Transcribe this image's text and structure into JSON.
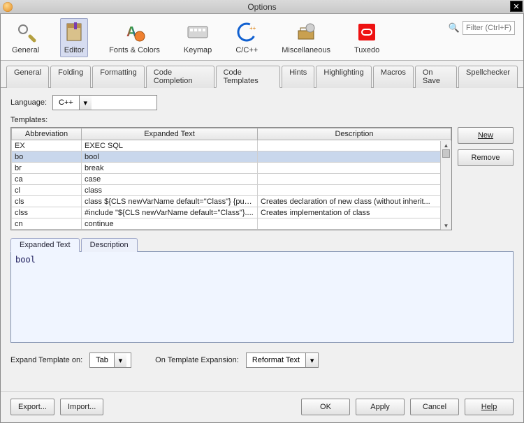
{
  "title": "Options",
  "search_placeholder": "Filter (Ctrl+F)",
  "toolbar": [
    {
      "label": "General"
    },
    {
      "label": "Editor",
      "selected": true
    },
    {
      "label": "Fonts & Colors"
    },
    {
      "label": "Keymap"
    },
    {
      "label": "C/C++"
    },
    {
      "label": "Miscellaneous"
    },
    {
      "label": "Tuxedo"
    }
  ],
  "inner_tabs": [
    "General",
    "Folding",
    "Formatting",
    "Code Completion",
    "Code Templates",
    "Hints",
    "Highlighting",
    "Macros",
    "On Save",
    "Spellchecker"
  ],
  "inner_tab_active": "Code Templates",
  "language_label": "Language:",
  "language_value": "C++",
  "templates_label": "Templates:",
  "columns": [
    "Abbreviation",
    "Expanded Text",
    "Description"
  ],
  "rows": [
    {
      "abbr": "EX",
      "exp": "EXEC SQL",
      "desc": ""
    },
    {
      "abbr": "bo",
      "exp": "bool",
      "desc": "",
      "selected": true
    },
    {
      "abbr": "br",
      "exp": "break",
      "desc": ""
    },
    {
      "abbr": "ca",
      "exp": "case",
      "desc": ""
    },
    {
      "abbr": "cl",
      "exp": "class",
      "desc": ""
    },
    {
      "abbr": "cls",
      "exp": "class ${CLS newVarName default=\"Class\"} {pub...",
      "desc": "Creates declaration of new class (without inherit..."
    },
    {
      "abbr": "clss",
      "exp": "#include \"${CLS newVarName default=\"Class\"}....",
      "desc": "Creates implementation of class"
    },
    {
      "abbr": "cn",
      "exp": "continue",
      "desc": ""
    }
  ],
  "side_buttons": {
    "new": "New",
    "remove": "Remove"
  },
  "sub_tabs": [
    "Expanded Text",
    "Description"
  ],
  "sub_tab_active": "Expanded Text",
  "editor_text": "bool",
  "expand_template_label": "Expand Template on:",
  "expand_template_value": "Tab",
  "on_expansion_label": "On Template Expansion:",
  "on_expansion_value": "Reformat Text",
  "bottom": {
    "export": "Export...",
    "import": "Import...",
    "ok": "OK",
    "apply": "Apply",
    "cancel": "Cancel",
    "help": "Help"
  }
}
